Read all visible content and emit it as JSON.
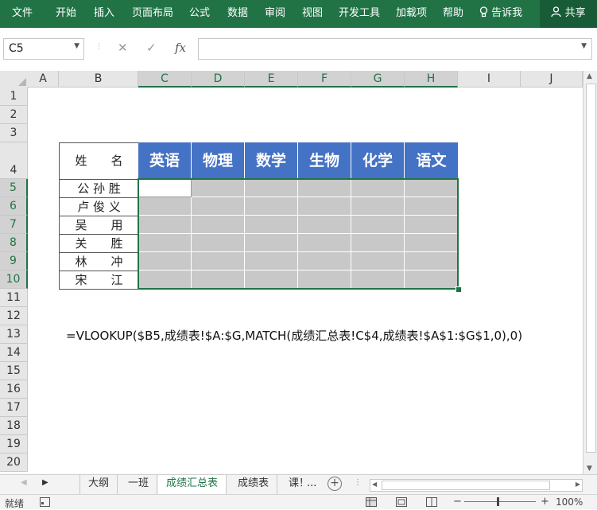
{
  "ribbon": {
    "tabs": [
      "文件",
      "开始",
      "插入",
      "页面布局",
      "公式",
      "数据",
      "审阅",
      "视图",
      "开发工具",
      "加载项",
      "帮助"
    ],
    "tell_me": "告诉我",
    "share": "共享"
  },
  "formula_bar": {
    "name_box": "C5",
    "cancel_icon": "✕",
    "enter_icon": "✓",
    "fx_icon": "fx",
    "formula": ""
  },
  "columns": [
    "A",
    "B",
    "C",
    "D",
    "E",
    "F",
    "G",
    "H",
    "I",
    "J"
  ],
  "rows": [
    "1",
    "2",
    "3",
    "4",
    "5",
    "6",
    "7",
    "8",
    "9",
    "10",
    "11",
    "12",
    "13",
    "14",
    "15",
    "16",
    "17",
    "18",
    "19",
    "20"
  ],
  "table": {
    "name_header": "姓　　名",
    "subjects": [
      "英语",
      "物理",
      "数学",
      "生物",
      "化学",
      "语文"
    ],
    "students": [
      "公 孙 胜",
      "卢 俊 义",
      "吴　　用",
      "关　　胜",
      "林　　冲",
      "宋　　江"
    ]
  },
  "annotation": "=VLOOKUP($B5,成绩表!$A:$G,MATCH(成绩汇总表!C$4,成绩表!$A$1:$G$1,0),0)",
  "sheet_tabs": [
    "大纲",
    "一班",
    "成绩汇总表",
    "成绩表",
    "课！"
  ],
  "active_sheet": "成绩汇总表",
  "more_sheets": "...",
  "status": {
    "mode": "就绪",
    "zoom": "100%"
  },
  "colors": {
    "ribbon": "#217346",
    "header_fill": "#4472c4",
    "gray_fill": "#c8c8c8",
    "selection": "#217346"
  }
}
